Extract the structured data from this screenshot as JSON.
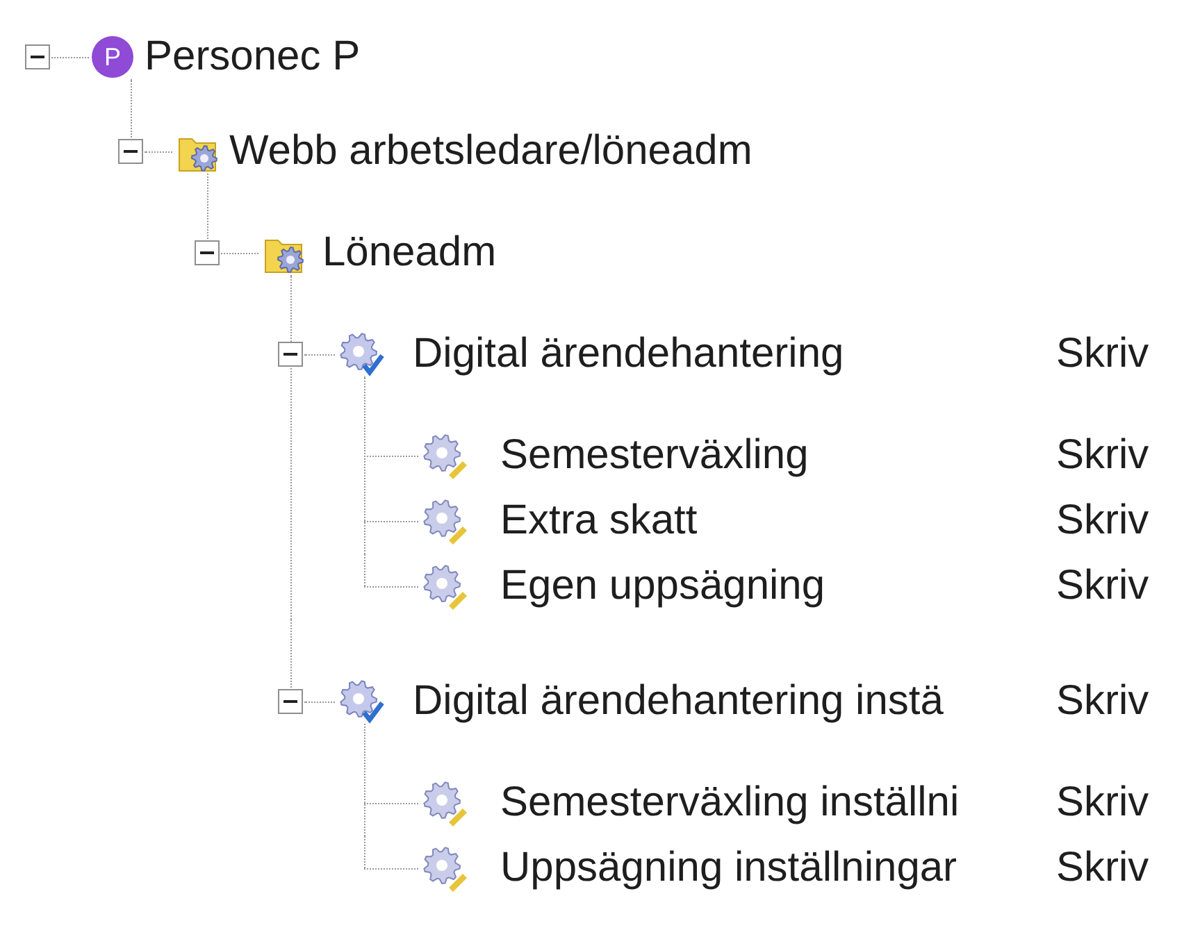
{
  "tree": [
    {
      "label": "Personec P",
      "kind": "root",
      "badge": "P",
      "expanded": true,
      "children": [
        {
          "label": "Webb arbetsledare/löneadm",
          "kind": "folder",
          "expanded": true,
          "children": [
            {
              "label": "Löneadm",
              "kind": "folder",
              "expanded": true,
              "children": [
                {
                  "label": "Digital ärendehantering",
                  "kind": "group",
                  "access": "Skriv",
                  "expanded": true,
                  "children": [
                    {
                      "label": "Semesterväxling",
                      "kind": "item",
                      "access": "Skriv"
                    },
                    {
                      "label": "Extra skatt",
                      "kind": "item",
                      "access": "Skriv"
                    },
                    {
                      "label": "Egen uppsägning",
                      "kind": "item",
                      "access": "Skriv"
                    }
                  ]
                },
                {
                  "label": "Digital ärendehantering instä",
                  "kind": "group",
                  "access": "Skriv",
                  "expanded": true,
                  "children": [
                    {
                      "label": "Semesterväxling inställni",
                      "kind": "item",
                      "access": "Skriv"
                    },
                    {
                      "label": "Uppsägning inställningar",
                      "kind": "item",
                      "access": "Skriv"
                    }
                  ]
                }
              ]
            }
          ]
        }
      ]
    }
  ]
}
